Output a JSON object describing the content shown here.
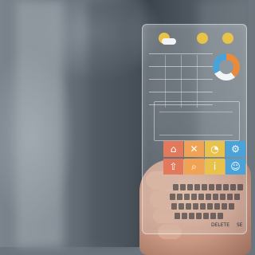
{
  "photo": {
    "subject": "",
    "device": {
      "weather_icons": [
        "partly-cloudy-icon",
        "sun-icon",
        "sun-icon"
      ],
      "chart_colors": [
        "#e98b3a",
        "#f3f5f6",
        "#4aa3d8"
      ],
      "tiles": [
        {
          "icon": "home-icon",
          "color": "#e3795b",
          "glyph": "⌂"
        },
        {
          "icon": "tools-icon",
          "color": "#f0a355",
          "glyph": "✕"
        },
        {
          "icon": "dashboard-icon",
          "color": "#e8c24a",
          "glyph": "◔"
        },
        {
          "icon": "settings-icon",
          "color": "#4aa3d8",
          "glyph": "⚙"
        },
        {
          "icon": "share-icon",
          "color": "#e3795b",
          "glyph": "⇧"
        },
        {
          "icon": "search-icon",
          "color": "#f0a355",
          "glyph": "⌕"
        },
        {
          "icon": "info-icon",
          "color": "#e8c24a",
          "glyph": "i"
        },
        {
          "icon": "user-icon",
          "color": "#4aa3d8",
          "glyph": "☺"
        }
      ],
      "keyboard_labels": {
        "delete": "DELETE",
        "send": "SE"
      }
    }
  }
}
